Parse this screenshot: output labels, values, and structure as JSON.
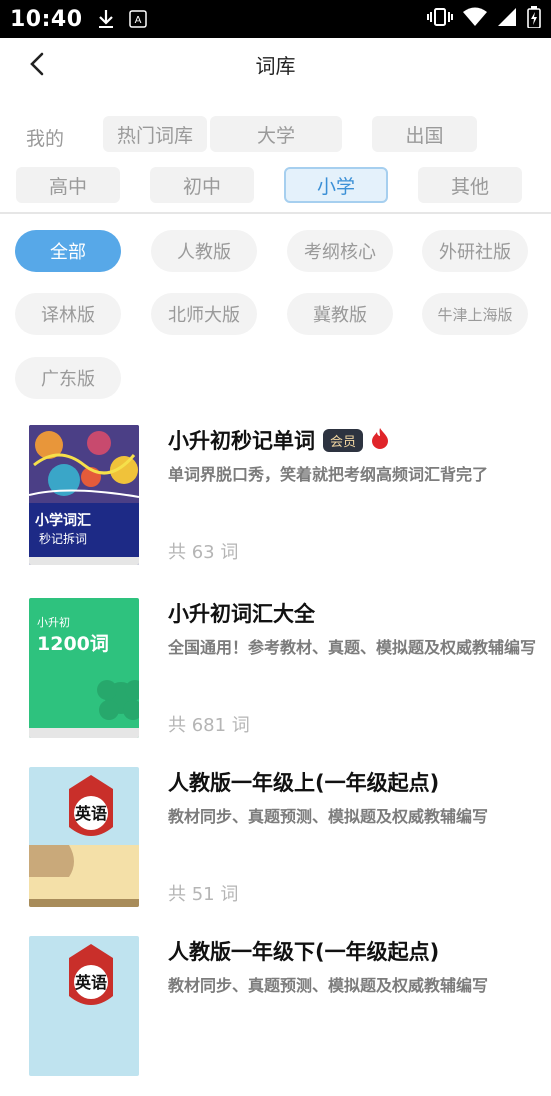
{
  "status_bar": {
    "time": "10:40",
    "icons": [
      "download-icon",
      "keyboard-icon",
      "vibrate-icon",
      "wifi-icon",
      "signal-icon",
      "battery-icon"
    ]
  },
  "navbar": {
    "back_icon": "chevron-left-icon",
    "title": "词库"
  },
  "categories": {
    "mine_label": "我的",
    "row1": [
      "热门词库",
      "大学",
      "出国"
    ],
    "row2": [
      "高中",
      "初中",
      "小学",
      "其他"
    ],
    "selected": "小学"
  },
  "subcategories": {
    "items": [
      "全部",
      "人教版",
      "考纲核心",
      "外研社版",
      "译林版",
      "北师大版",
      "冀教版",
      "牛津上海版",
      "广东版"
    ],
    "selected": "全部"
  },
  "books": [
    {
      "title": "小升初秒记单词",
      "badge": "会员",
      "hot_icon": "fire-icon",
      "description": "单词界脱口秀，笑着就把考纲高频词汇背完了",
      "count": "共 63 词",
      "cover_text_1": "小学词汇",
      "cover_text_2": "秒记拆词"
    },
    {
      "title": "小升初词汇大全",
      "description": "全国通用！参考教材、真题、模拟题及权威教辅编写",
      "count": "共 681 词",
      "cover_text_1": "小升初",
      "cover_text_2": "1200词"
    },
    {
      "title": "人教版一年级上(一年级起点)",
      "description": "教材同步、真题预测、模拟题及权威教辅编写",
      "count": "共 51 词",
      "cover_text_1": "英语"
    },
    {
      "title": "人教版一年级下(一年级起点)",
      "description": "教材同步、真题预测、模拟题及权威教辅编写",
      "cover_text_1": "英语"
    }
  ],
  "colors": {
    "accent": "#57a8e8",
    "vip_badge_bg": "#2d3340",
    "vip_badge_text": "#f1d6a2",
    "hot": "#e0252a",
    "green_cover": "#2ec27e"
  }
}
